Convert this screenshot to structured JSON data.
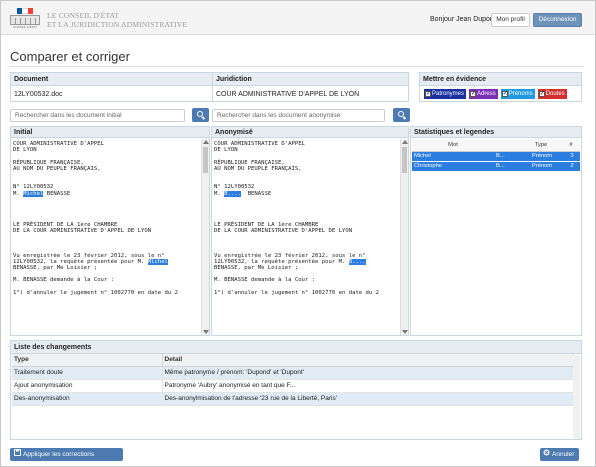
{
  "header": {
    "org_line1": "LE CONSEIL D'ÉTAT",
    "org_line2": "ET LA JURIDICTION ADMINISTRATIVE",
    "logo_caption": "CONSEIL D'ÉTAT",
    "greeting": "Bonjour Jean Dupont",
    "profile_button": "Mon profil",
    "logout_button": "Déconnexion",
    "flag_colors": [
      "#0055a4",
      "#ffffff",
      "#ef4135"
    ]
  },
  "page_title": "Comparer et corriger",
  "info": {
    "document_header": "Document",
    "document_value": "12LY00532.doc",
    "juridiction_header": "Juridiction",
    "juridiction_value": "COUR ADMINISTRATIVE D'APPEL DE LYON"
  },
  "highlight": {
    "header": "Mettre en évidence",
    "tags": [
      {
        "label": "Patronymes",
        "color": "#1a2fa0"
      },
      {
        "label": "Adress",
        "color": "#7a2fb5"
      },
      {
        "label": "Prénoms",
        "color": "#1f9ae0"
      },
      {
        "label": "Doutes",
        "color": "#d32f2f"
      }
    ]
  },
  "search": {
    "initial_placeholder": "Rechercher dans les document initial",
    "anon_placeholder": "Rechercher dans les document anonymise",
    "button_icon": "search-icon"
  },
  "initial": {
    "header": "Initial",
    "text": {
      "l1": "COUR ADMINISTRATIVE D'APPEL",
      "l2": "DE LYON",
      "l3": "RÉPUBLIQUE FRANÇAISE,",
      "l4": "AU NOM DU PEUPLE FRANÇAIS,",
      "l5": "N° 12LY00532",
      "l6a": "M. ",
      "l6b": "Michel",
      "l6c": " BENASSE",
      "l7": "LE PRÉSIDENT DE LA 1ère CHAMBRE",
      "l8": "DE LA COUR ADMINISTRATIVE D'APPEL DE LYON",
      "l9": "Vu enregistrée le 23 février 2012, sous le n°",
      "l10a": "12LY00532, la requête présentée pour M. ",
      "l10b": "Michel",
      "l11": "BENASSE, par Me Loisier ;",
      "l12": "M. BENASSE demande à la Cour :",
      "l13": "1°) d'annuler le jugement n° 1002770 en date du 2"
    }
  },
  "anon": {
    "header": "Anonymisé",
    "text": {
      "l1": "COUR ADMINISTRATIVE D'APPEL",
      "l2": "DE LYON",
      "l3": "RÉPUBLIQUE FRANÇAISE,",
      "l4": "AU NOM DU PEUPLE FRANÇAIS,",
      "l5": "N° 12LY00532",
      "l6a": "M. ",
      "l6b": "B....",
      "l6c": "  BENASSE",
      "l7": "LE PRÉSIDENT DE LA 1ère CHAMBRE",
      "l8": "DE LA COUR ADMINISTRATIVE D'APPEL DE LYON",
      "l9": "Vu enregistrée le 23 février 2012, sous le n°",
      "l10a": "12LY00532, la requête présentée pour M. ",
      "l10b": "B....",
      "l11": "BENASSE, par Me Loisier ;",
      "l12": "M. BENASSE demande à la Cour :",
      "l13": "1°) d'annuler le jugement n° 1002770 en date du 2"
    }
  },
  "stats": {
    "header": "Statistiques et legendes",
    "columns": [
      "Mot",
      "",
      "Type",
      "#"
    ],
    "rows": [
      {
        "mot": "Michel",
        "abbr": "B...",
        "type": "Prénom",
        "count": "3"
      },
      {
        "mot": "Christophe",
        "abbr": "B...",
        "type": "Prénom",
        "count": "2"
      }
    ]
  },
  "changes": {
    "header": "Liste des changements",
    "col_type": "Type",
    "col_detail": "Detail",
    "rows": [
      {
        "type": "Traitement doute",
        "detail": "Même patronyme / prénom: 'Dupond' et 'Dupont'"
      },
      {
        "type": "Ajout anonymisation",
        "detail": "Patronyme 'Aubry' anonymisé en tant que F..."
      },
      {
        "type": "Des-anonymisation",
        "detail": "Des-anonylmisation de l'adresse '23 rue de la Liberté, Paris'"
      }
    ]
  },
  "actions": {
    "apply": "Appliquer les corrections",
    "cancel": "Annuler"
  }
}
